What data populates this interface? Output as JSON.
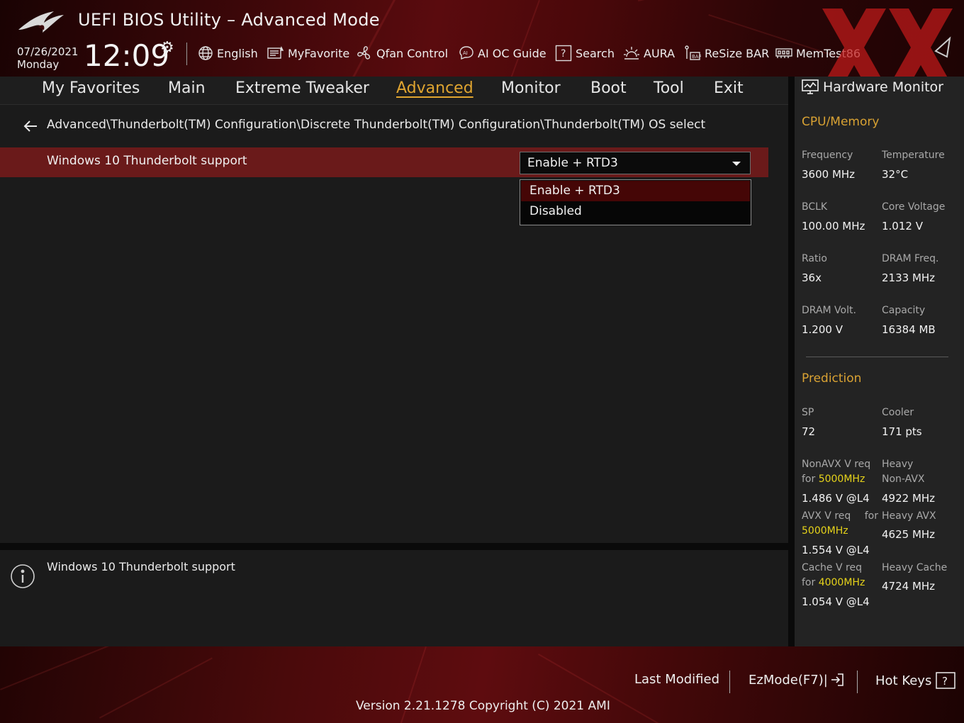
{
  "header": {
    "title": "UEFI BIOS Utility – Advanced Mode",
    "date": "07/26/2021",
    "day": "Monday",
    "time": "12:09",
    "toolbar": [
      {
        "label": "English",
        "icon": "globe-icon"
      },
      {
        "label": "MyFavorite",
        "icon": "favorite-list-icon"
      },
      {
        "label": "Qfan Control",
        "icon": "fan-icon"
      },
      {
        "label": "AI OC Guide",
        "icon": "ai-chip-icon"
      },
      {
        "label": "Search",
        "icon": "search-help-icon"
      },
      {
        "label": "AURA",
        "icon": "aura-light-icon"
      },
      {
        "label": "ReSize BAR",
        "icon": "resize-bar-icon"
      },
      {
        "label": "MemTest86",
        "icon": "memory-icon"
      }
    ]
  },
  "tabs": [
    "My Favorites",
    "Main",
    "Extreme Tweaker",
    "Advanced",
    "Monitor",
    "Boot",
    "Tool",
    "Exit"
  ],
  "active_tab": "Advanced",
  "breadcrumb": "Advanced\\Thunderbolt(TM) Configuration\\Discrete Thunderbolt(TM) Configuration\\Thunderbolt(TM) OS select",
  "setting": {
    "label": "Windows 10 Thunderbolt support",
    "value": "Enable + RTD3",
    "options": [
      "Enable + RTD3",
      "Disabled"
    ]
  },
  "help_text": "Windows 10 Thunderbolt support",
  "hardware_monitor": {
    "title": "Hardware Monitor",
    "cpu_memory": {
      "title": "CPU/Memory",
      "frequency_label": "Frequency",
      "frequency": "3600 MHz",
      "temperature_label": "Temperature",
      "temperature": "32°C",
      "bclk_label": "BCLK",
      "bclk": "100.00 MHz",
      "core_voltage_label": "Core Voltage",
      "core_voltage": "1.012 V",
      "ratio_label": "Ratio",
      "ratio": "36x",
      "dram_freq_label": "DRAM Freq.",
      "dram_freq": "2133 MHz",
      "dram_volt_label": "DRAM Volt.",
      "dram_volt": "1.200 V",
      "capacity_label": "Capacity",
      "capacity": "16384 MB"
    },
    "prediction": {
      "title": "Prediction",
      "sp_label": "SP",
      "sp": "72",
      "cooler_label": "Cooler",
      "cooler": "171 pts",
      "nonavx_label_1": "NonAVX V req",
      "nonavx_label_2_prefix": "for ",
      "nonavx_freq": "5000MHz",
      "nonavx_value": "1.486 V @L4",
      "heavy_nonavx_label_1": "Heavy",
      "heavy_nonavx_label_2": "Non-AVX",
      "heavy_nonavx_value": "4922 MHz",
      "avx_label": "AVX V req",
      "avx_for": "for",
      "avx_freq": "5000MHz",
      "avx_value": "1.554 V @L4",
      "heavy_avx_label": "Heavy AVX",
      "heavy_avx_value": "4625 MHz",
      "cache_label": "Cache V req",
      "cache_prefix": "for ",
      "cache_freq": "4000MHz",
      "cache_value": "1.054 V @L4",
      "heavy_cache_label": "Heavy Cache",
      "heavy_cache_value": "4724 MHz"
    }
  },
  "footer": {
    "last_modified": "Last Modified",
    "ezmode": "EzMode(F7)|",
    "hotkeys": "Hot Keys",
    "version": "Version 2.21.1278 Copyright (C) 2021 AMI"
  },
  "colors": {
    "accent": "#e0a530",
    "highlight_value": "#e6d31a",
    "selected_row": "#6a1a1a",
    "header_red": "#5a0b0e"
  }
}
